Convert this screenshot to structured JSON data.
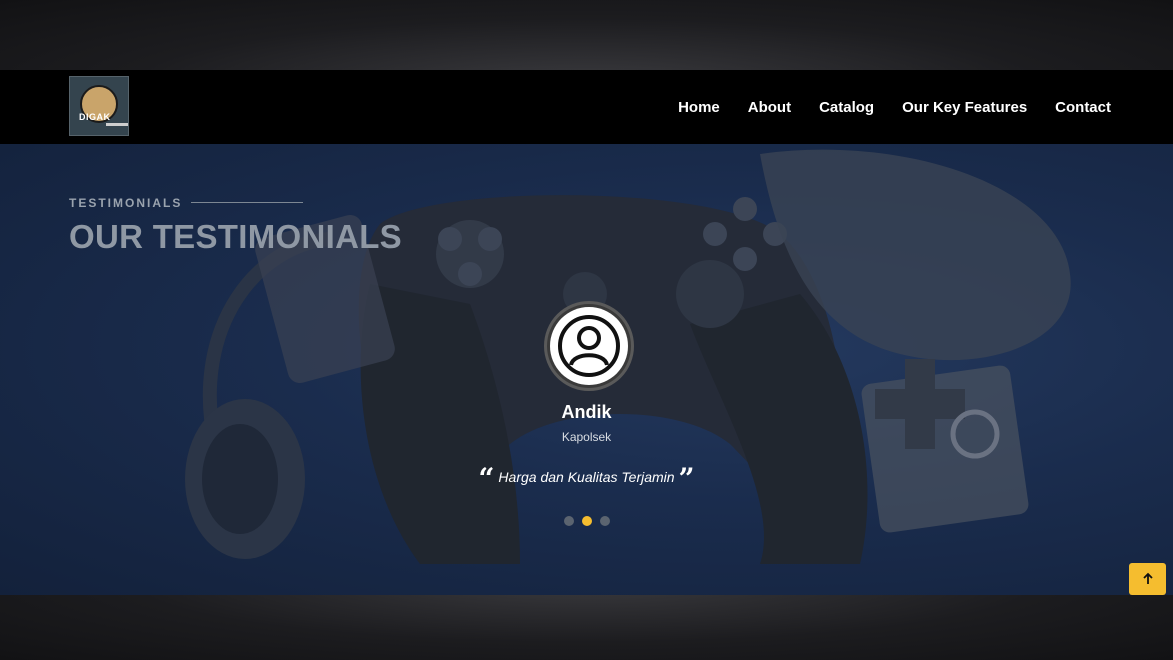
{
  "nav": {
    "logo_text": "DIGAK",
    "links": [
      "Home",
      "About",
      "Catalog",
      "Our Key Features",
      "Contact"
    ]
  },
  "testimonials": {
    "section_label": "TESTIMONIALS",
    "title": "OUR TESTIMONIALS",
    "active_slide": 2,
    "slide_count": 3,
    "item": {
      "name": "Andik",
      "role": "Kapolsek",
      "quote": "Harga dan Kualitas Terjamin"
    }
  },
  "back_to_top": {
    "icon": "arrow-up-icon"
  },
  "colors": {
    "accent": "#f5bd2f",
    "navbar": "#000000",
    "hero": "#1a2c4d"
  }
}
